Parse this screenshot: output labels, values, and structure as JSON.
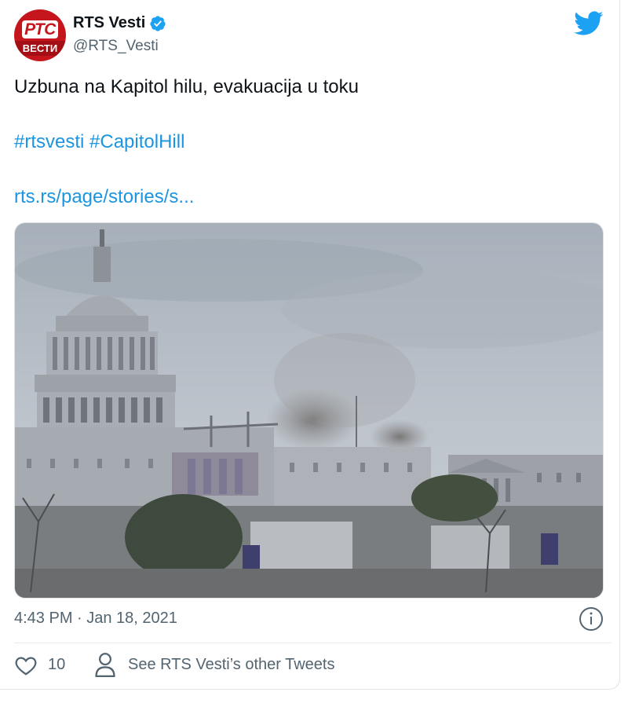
{
  "tweet": {
    "author_name": "RTS Vesti",
    "author_handle": "@RTS_Vesti",
    "avatar_logo_top": "РТС",
    "avatar_logo_bottom": "ВЕСТИ",
    "verified": true,
    "text": "Uzbuna na Kapitol hilu, evakuacija u toku",
    "hashtags": "#rtsvesti #CapitolHill",
    "link": "rts.rs/page/stories/s...",
    "timestamp": "4:43 PM · Jan 18, 2021",
    "likes": "10",
    "see_other_label": "See RTS Vesti’s other Tweets"
  },
  "colors": {
    "link": "#1b95e0",
    "twitter_blue": "#1da1f2",
    "muted": "#536471",
    "avatar_red": "#c4161c"
  },
  "icons": {
    "brand": "twitter-bird-icon",
    "verified": "verified-badge-icon",
    "info": "info-icon",
    "like": "heart-icon",
    "profile": "person-icon"
  }
}
